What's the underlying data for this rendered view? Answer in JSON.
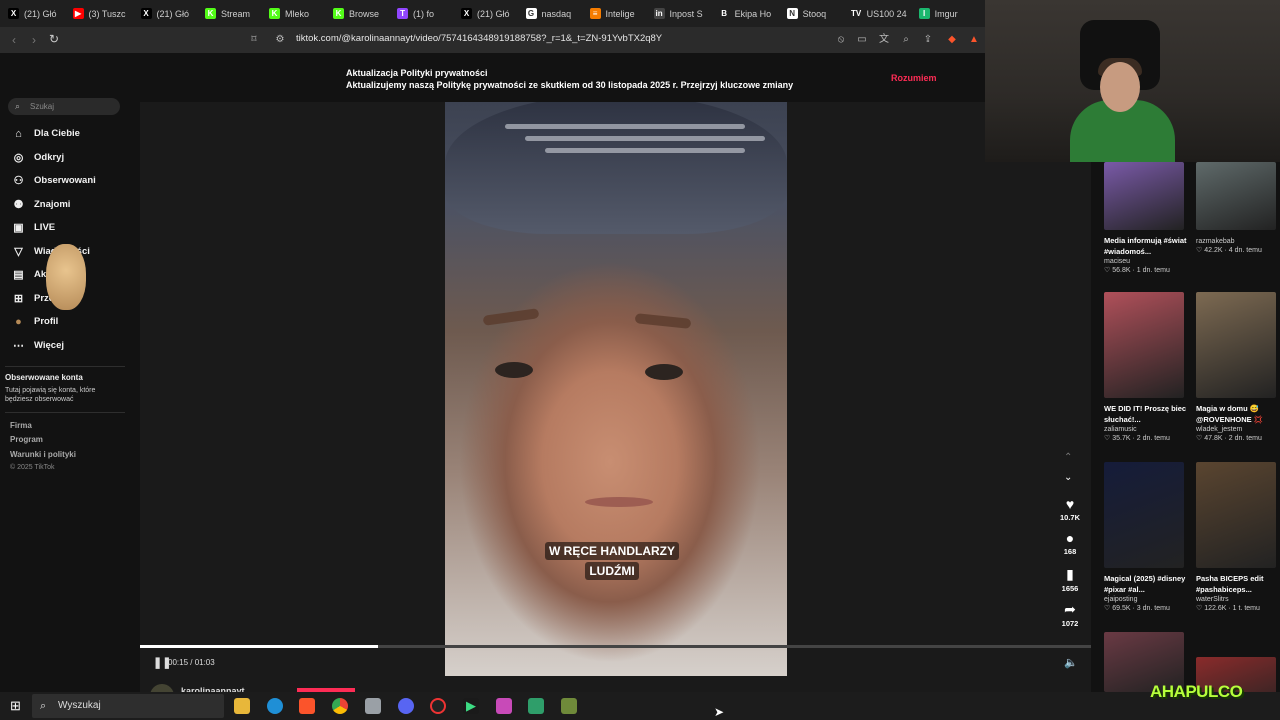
{
  "browser": {
    "tabs": [
      {
        "label": "(21) Głó",
        "icon": "x-logo-icon",
        "color": "#000000",
        "glyph": "X"
      },
      {
        "label": "(3) Tuszc",
        "icon": "youtube-icon",
        "color": "#ff0000",
        "glyph": "▶"
      },
      {
        "label": "(21) Głó",
        "icon": "x-logo-icon",
        "color": "#000000",
        "glyph": "X"
      },
      {
        "label": "Stream",
        "icon": "kick-icon",
        "color": "#53fc18",
        "glyph": "K"
      },
      {
        "label": "Mleko",
        "icon": "kick-icon",
        "color": "#53fc18",
        "glyph": "K"
      },
      {
        "label": "Browse",
        "icon": "kick-icon",
        "color": "#53fc18",
        "glyph": "K"
      },
      {
        "label": "(1) fo",
        "icon": "twitch-icon",
        "color": "#9146ff",
        "glyph": "T"
      },
      {
        "label": "(21) Głó",
        "icon": "x-logo-icon",
        "color": "#000000",
        "glyph": "X"
      },
      {
        "label": "nasdaq",
        "icon": "google-icon",
        "color": "#ffffff",
        "glyph": "G"
      },
      {
        "label": "Intelige",
        "icon": "layers-icon",
        "color": "#f57c00",
        "glyph": "≡"
      },
      {
        "label": "Inpost S",
        "icon": "investing-icon",
        "color": "#444444",
        "glyph": "in"
      },
      {
        "label": "Ekipa Ho",
        "icon": "b-icon",
        "color": "#1f1f1f",
        "glyph": "B"
      },
      {
        "label": "Stooq",
        "icon": "stooq-icon",
        "color": "#ffffff",
        "glyph": "N"
      },
      {
        "label": "US100 24",
        "icon": "tradingview-icon",
        "color": "#1f1f1f",
        "glyph": "TV"
      },
      {
        "label": "Imgur",
        "icon": "imgur-icon",
        "color": "#1bb76e",
        "glyph": "I"
      }
    ],
    "url": "tiktok.com/@karolinaannayt/video/7574164348919188758?_r=1&_t=ZN-91YvbTX2q8Y"
  },
  "banner": {
    "title": "Aktualizacja Polityki prywatności",
    "text": "Aktualizujemy naszą Politykę prywatności ze skutkiem od 30 listopada 2025 r. Przejrzyj kluczowe zmiany",
    "button": "Rozumiem"
  },
  "sidebar": {
    "search_placeholder": "Szukaj",
    "items": [
      {
        "label": "Dla Ciebie",
        "icon": "home-icon"
      },
      {
        "label": "Odkryj",
        "icon": "compass-icon"
      },
      {
        "label": "Obserwowani",
        "icon": "user-follow-icon"
      },
      {
        "label": "Znajomi",
        "icon": "friends-icon"
      },
      {
        "label": "LIVE",
        "icon": "live-icon"
      },
      {
        "label": "Wiadomości",
        "icon": "send-icon"
      },
      {
        "label": "Aktywność",
        "icon": "activity-icon"
      },
      {
        "label": "Prześlij",
        "icon": "upload-icon"
      },
      {
        "label": "Profil",
        "icon": "avatar-icon"
      },
      {
        "label": "Więcej",
        "icon": "more-icon"
      }
    ],
    "followed_heading": "Obserwowane konta",
    "followed_desc": "Tutaj pojawią się konta, które będziesz obserwować",
    "footer": [
      "Firma",
      "Program",
      "Warunki i polityki"
    ],
    "copyright": "© 2025 TikTok"
  },
  "video": {
    "subtitle_line1": "W RĘCE HANDLARZY",
    "subtitle_line2": "LUDŹMI",
    "time": "00:15 / 01:03",
    "progress": 0.25,
    "author": "karolinaannayt"
  },
  "actions": {
    "likes": "10.7K",
    "comments": "168",
    "saves": "1656",
    "shares": "1072"
  },
  "suggested": [
    {
      "title": "Media informują #świat #wiadomoś...",
      "user": "maciseu",
      "views": "56.8K",
      "age": "1 dn. temu",
      "color": "#7a5aa8"
    },
    {
      "title": "",
      "user": "razmakebab",
      "views": "42.2K",
      "age": "4 dn. temu",
      "color": "#5f6a6a"
    },
    {
      "title": "WE DID IT! Proszę biec słuchać!...",
      "user": "zaliamusic",
      "views": "35.7K",
      "age": "2 dn. temu",
      "color": "#b0505a"
    },
    {
      "title": "Magia w domu 😅 @ROVENHONE 💢",
      "user": "wladek_jestem",
      "views": "47.8K",
      "age": "2 dn. temu",
      "color": "#7d6a52"
    },
    {
      "title": "Magical (2025) #disney #pixar #al...",
      "user": "ejaiposting",
      "views": "69.5K",
      "age": "3 dn. temu",
      "color": "#151c3a"
    },
    {
      "title": "Pasha BICEPS edit #pashabiceps...",
      "user": "waterSlitrs",
      "views": "122.6K",
      "age": "1 t. temu",
      "color": "#5a4530"
    },
    {
      "title": "",
      "user": "",
      "views": "",
      "age": "",
      "color": "#6a3a44"
    },
    {
      "title": "",
      "user": "",
      "views": "",
      "age": "",
      "color": "#8a2b2b"
    }
  ],
  "taskbar": {
    "search_placeholder": "Wyszukaj"
  },
  "stream_overlay": {
    "logo": "AHAPULCO"
  }
}
